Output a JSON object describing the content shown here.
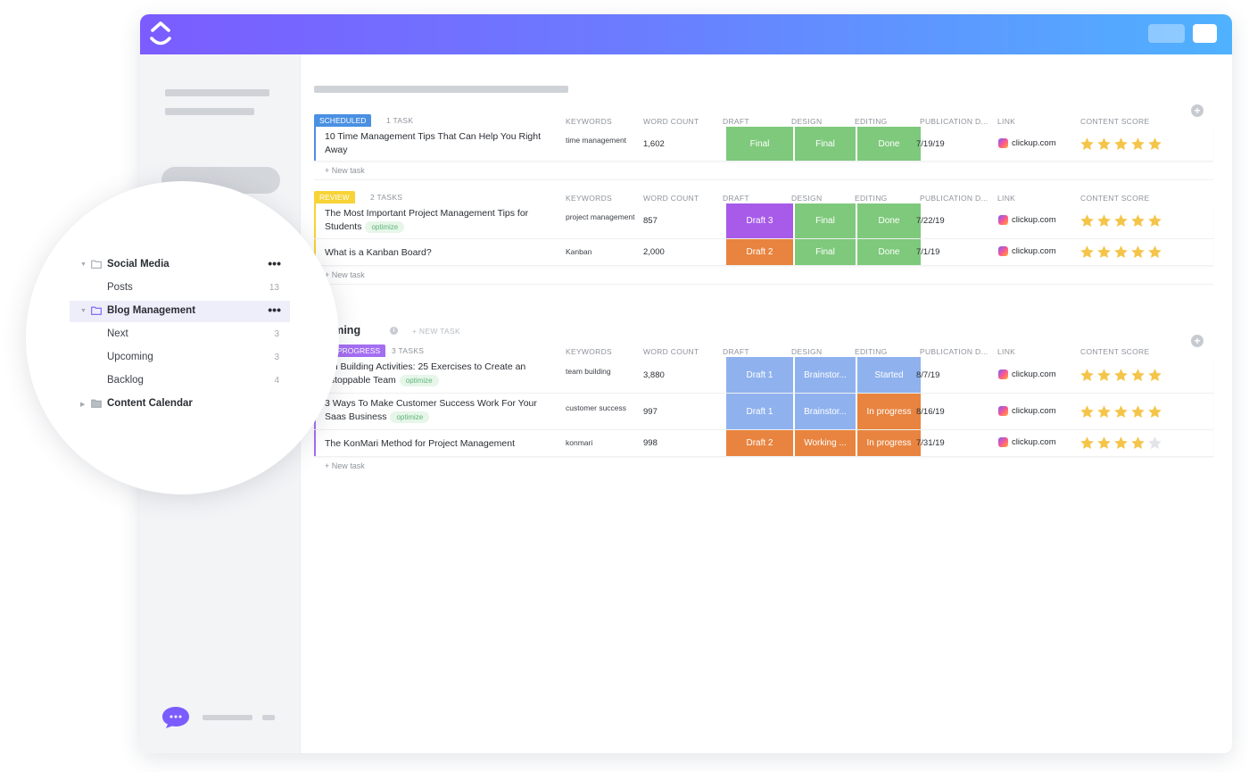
{
  "colors": {
    "brand_purple": "#7b5cff",
    "scheduled": "#4a90e2",
    "review": "#f7d335",
    "in_progress": "#a46ef2",
    "green": "#7ec97b",
    "purple": "#a75be8",
    "orange": "#e8843f",
    "blue": "#8fb2ee",
    "star_on": "#f4c54a",
    "star_off": "#e2e4e8"
  },
  "icons": {
    "logo": "clickup-logo-icon",
    "chat": "chat-bubble-icon",
    "folder": "folder-icon",
    "link": "clickup-link-icon",
    "star": "star-icon",
    "add": "plus-circle-icon",
    "info": "info-icon"
  },
  "columns": {
    "keywords": "KEYWORDS",
    "word_count": "WORD COUNT",
    "draft": "DRAFT",
    "design": "DESIGN",
    "editing": "EDITING",
    "publication_date": "PUBLICATION D...",
    "link": "LINK",
    "content_score": "CONTENT SCORE"
  },
  "new_task_label": "+ New task",
  "groups": [
    {
      "status": "SCHEDULED",
      "count": "1 TASK",
      "rows": [
        {
          "name": "10 Time Management Tips That Can Help You Right Away",
          "tag": "",
          "keywords": "time management",
          "word_count": "1,602",
          "draft": "Final",
          "design": "Final",
          "editing": "Done",
          "date": "7/19/19",
          "link": "clickup.com",
          "score": 5
        }
      ]
    },
    {
      "status": "REVIEW",
      "count": "2 TASKS",
      "rows": [
        {
          "name": "The Most Important Project Management Tips for Students",
          "tag": "optimize",
          "keywords": "project management",
          "word_count": "857",
          "draft": "Draft 3",
          "design": "Final",
          "editing": "Done",
          "date": "7/22/19",
          "link": "clickup.com",
          "score": 5
        },
        {
          "name": "What is a Kanban Board?",
          "tag": "",
          "keywords": "Kanban",
          "word_count": "2,000",
          "draft": "Draft 2",
          "design": "Final",
          "editing": "Done",
          "date": "7/1/19",
          "link": "clickup.com",
          "score": 5
        }
      ]
    },
    {
      "status": "PROGRESS",
      "count": "3 TASKS",
      "rows": [
        {
          "name": "am Building Activities: 25 Exercises to Create an nstoppable Team",
          "tag": "optimize",
          "keywords": "team building",
          "word_count": "3,880",
          "draft": "Draft 1",
          "design": "Brainstor...",
          "editing": "Started",
          "date": "8/7/19",
          "link": "clickup.com",
          "score": 5
        },
        {
          "name": "3 Ways To Make Customer Success Work For Your Saas Business",
          "tag": "optimize",
          "keywords": "customer success",
          "word_count": "997",
          "draft": "Draft 1",
          "design": "Brainstor...",
          "editing": "In progress",
          "date": "8/16/19",
          "link": "clickup.com",
          "score": 5
        },
        {
          "name": "The KonMari Method for Project Management",
          "tag": "",
          "keywords": "konmari",
          "word_count": "998",
          "draft": "Draft 2",
          "design": "Working ...",
          "editing": "In progress",
          "date": "7/31/19",
          "link": "clickup.com",
          "score": 4
        }
      ]
    }
  ],
  "upcoming": {
    "title": "pcoming",
    "new_task": "+ NEW TASK"
  },
  "sidebar_zoom": {
    "items": [
      {
        "label": "Social Media",
        "type": "folder",
        "more": "•••"
      },
      {
        "label": "Posts",
        "type": "list",
        "count": "13"
      },
      {
        "label": "Blog Management",
        "type": "folder",
        "more": "•••",
        "active": true
      },
      {
        "label": "Next",
        "type": "list",
        "count": "3"
      },
      {
        "label": "Upcoming",
        "type": "list",
        "count": "3"
      },
      {
        "label": "Backlog",
        "type": "list",
        "count": "4"
      },
      {
        "label": "Content Calendar",
        "type": "folder"
      }
    ]
  }
}
